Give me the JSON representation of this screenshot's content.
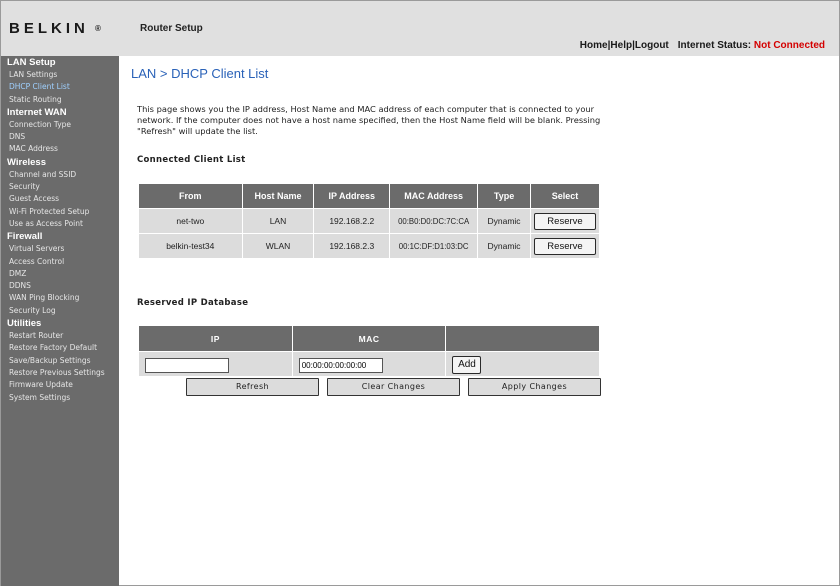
{
  "header": {
    "logo": "BELKIN",
    "logo_mark": "®",
    "title": "Router Setup",
    "links": [
      "Home",
      "Help",
      "Logout"
    ],
    "status_label": "Internet Status:",
    "status_value": "Not Connected",
    "status_color": "#d40000"
  },
  "sidebar": {
    "sections": [
      {
        "title": "LAN Setup",
        "items": [
          "LAN Settings",
          "DHCP Client List",
          "Static Routing"
        ]
      },
      {
        "title": "Internet WAN",
        "items": [
          "Connection Type",
          "DNS",
          "MAC Address"
        ]
      },
      {
        "title": "Wireless",
        "items": [
          "Channel and SSID",
          "Security",
          "Guest Access",
          "Wi-Fi Protected Setup",
          "Use as Access Point"
        ]
      },
      {
        "title": "Firewall",
        "items": [
          "Virtual Servers",
          "Access Control",
          "DMZ",
          "DDNS",
          "WAN Ping Blocking",
          "Security Log"
        ]
      },
      {
        "title": "Utilities",
        "items": [
          "Restart Router",
          "Restore Factory Default",
          "Save/Backup Settings",
          "Restore Previous Settings",
          "Firmware Update",
          "System Settings"
        ]
      }
    ],
    "active_item": "DHCP Client List"
  },
  "main": {
    "title": "LAN > DHCP Client List",
    "intro": "This page shows you the IP address, Host Name and MAC address of each computer that is connected to your network. If the computer does not have a host name specified, then the Host Name field will be blank. Pressing \"Refresh\" will update the list.",
    "connected_heading": "Connected Client List",
    "columns": [
      "From",
      "Host Name",
      "IP Address",
      "MAC Address",
      "Type",
      "Select"
    ],
    "clients": [
      {
        "from": "net-two",
        "host": "LAN",
        "ip": "192.168.2.2",
        "mac": "00:B0:D0:DC:7C:CA",
        "type": "Dynamic",
        "action": "Reserve"
      },
      {
        "from": "belkin-test34",
        "host": "WLAN",
        "ip": "192.168.2.3",
        "mac": "00:1C:DF:D1:03:DC",
        "type": "Dynamic",
        "action": "Reserve"
      }
    ],
    "reserved_heading": "Reserved IP Database",
    "reserved_columns": [
      "IP",
      "MAC"
    ],
    "ip_value": "",
    "mac_value": "00:00:00:00:00:00",
    "add_label": "Add",
    "refresh_label": "Refresh",
    "clear_label": "Clear Changes",
    "apply_label": "Apply Changes"
  }
}
